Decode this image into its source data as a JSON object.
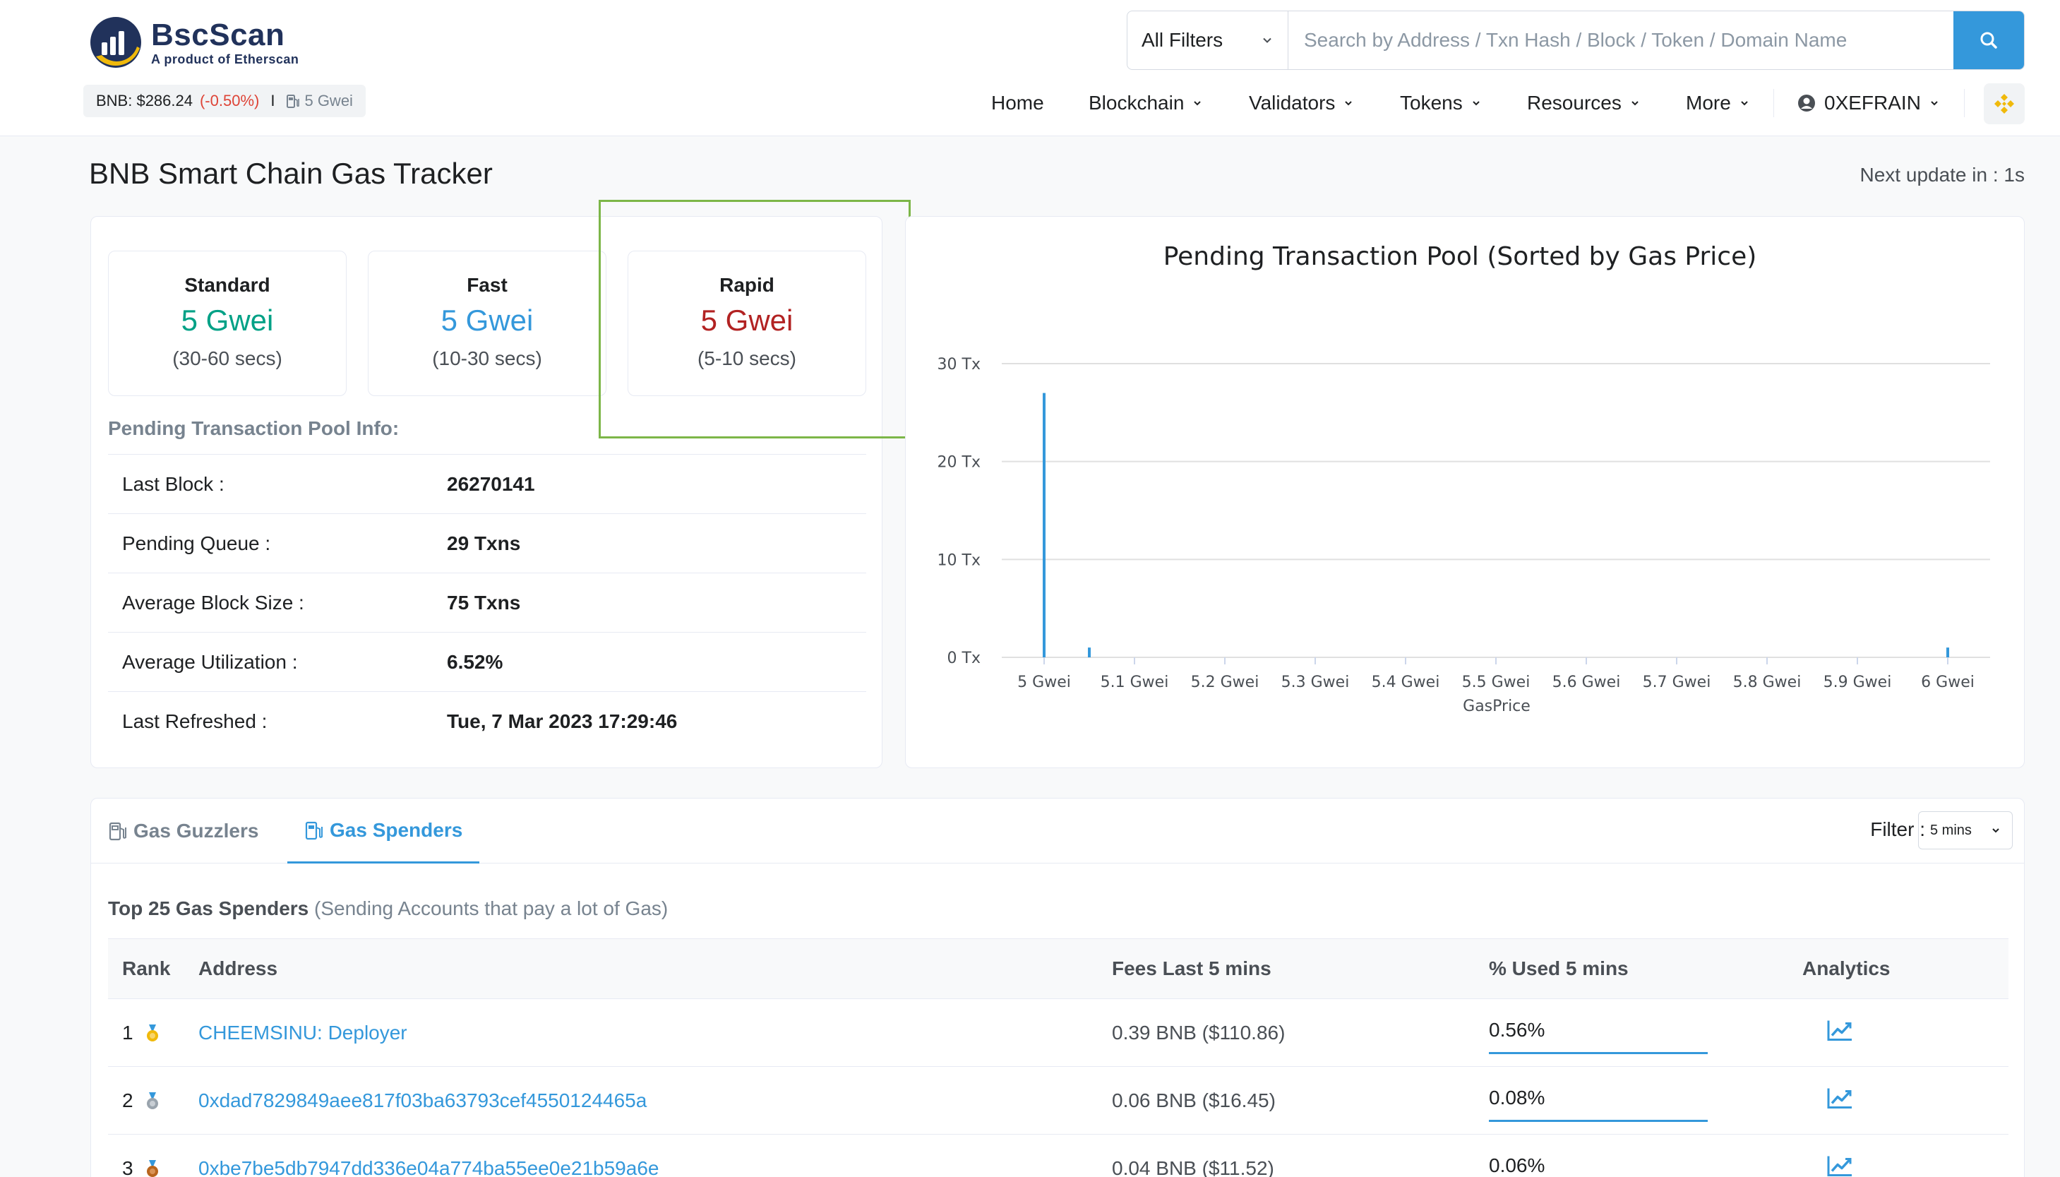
{
  "brand": {
    "name": "BscScan",
    "tagline": "A product of Etherscan"
  },
  "ticker": {
    "label": "BNB: $286.24",
    "change": "(-0.50%)",
    "separator": "I",
    "gas": "5 Gwei"
  },
  "search": {
    "filter": "All Filters",
    "placeholder": "Search by Address / Txn Hash / Block / Token / Domain Name"
  },
  "nav": {
    "home": "Home",
    "blockchain": "Blockchain",
    "validators": "Validators",
    "tokens": "Tokens",
    "resources": "Resources",
    "more": "More",
    "account": "0XEFRAIN"
  },
  "page": {
    "title": "BNB Smart Chain Gas Tracker",
    "next_update": "Next update in : 1s"
  },
  "speeds": [
    {
      "label": "Standard",
      "value": "5 Gwei",
      "time": "(30-60 secs)",
      "color": "#00a186"
    },
    {
      "label": "Fast",
      "value": "5 Gwei",
      "time": "(10-30 secs)",
      "color": "#3498db"
    },
    {
      "label": "Rapid",
      "value": "5 Gwei",
      "time": "(5-10 secs)",
      "color": "#b22222"
    }
  ],
  "pool": {
    "heading": "Pending Transaction Pool Info:",
    "rows": [
      {
        "label": "Last Block :",
        "value": "26270141"
      },
      {
        "label": "Pending Queue :",
        "value": "29 Txns"
      },
      {
        "label": "Average Block Size :",
        "value": "75 Txns"
      },
      {
        "label": "Average Utilization :",
        "value": "6.52%"
      },
      {
        "label": "Last Refreshed :",
        "value": "Tue, 7 Mar 2023 17:29:46"
      }
    ]
  },
  "chart_data": {
    "type": "bar",
    "title": "Pending Transaction Pool (Sorted by Gas Price)",
    "xlabel": "GasPrice",
    "ylabel": "",
    "x_ticks": [
      "5 Gwei",
      "5.1 Gwei",
      "5.2 Gwei",
      "5.3 Gwei",
      "5.4 Gwei",
      "5.5 Gwei",
      "5.6 Gwei",
      "5.7 Gwei",
      "5.8 Gwei",
      "5.9 Gwei",
      "6 Gwei"
    ],
    "y_ticks": [
      "0 Tx",
      "10 Tx",
      "20 Tx",
      "30 Tx"
    ],
    "ylim": [
      0,
      30
    ],
    "xlim": [
      5,
      6
    ],
    "grid": true,
    "points": [
      {
        "x": 5.0,
        "y": 27
      },
      {
        "x": 5.05,
        "y": 1
      },
      {
        "x": 6.0,
        "y": 1
      }
    ],
    "color": "#3498db"
  },
  "spenders": {
    "tabs": {
      "guzzlers": "Gas Guzzlers",
      "spenders": "Gas Spenders"
    },
    "filter_label": "Filter :",
    "filter_value": "5 mins",
    "title_bold": "Top 25 Gas Spenders",
    "title_rest": "(Sending Accounts that pay a lot of Gas)",
    "columns": {
      "rank": "Rank",
      "address": "Address",
      "fees": "Fees Last 5 mins",
      "used": "% Used 5 mins",
      "analytics": "Analytics"
    },
    "rows": [
      {
        "rank": "1",
        "medal": "gold",
        "address": "CHEEMSINU: Deployer",
        "fees": "0.39 BNB ($110.86)",
        "used": "0.56%"
      },
      {
        "rank": "2",
        "medal": "silver",
        "address": "0xdad7829849aee817f03ba63793cef4550124465a",
        "fees": "0.06 BNB ($16.45)",
        "used": "0.08%"
      },
      {
        "rank": "3",
        "medal": "bronze",
        "address": "0xbe7be5db7947dd336e04a774ba55ee0e21b59a6e",
        "fees": "0.04 BNB ($11.52)",
        "used": "0.06%"
      }
    ]
  }
}
